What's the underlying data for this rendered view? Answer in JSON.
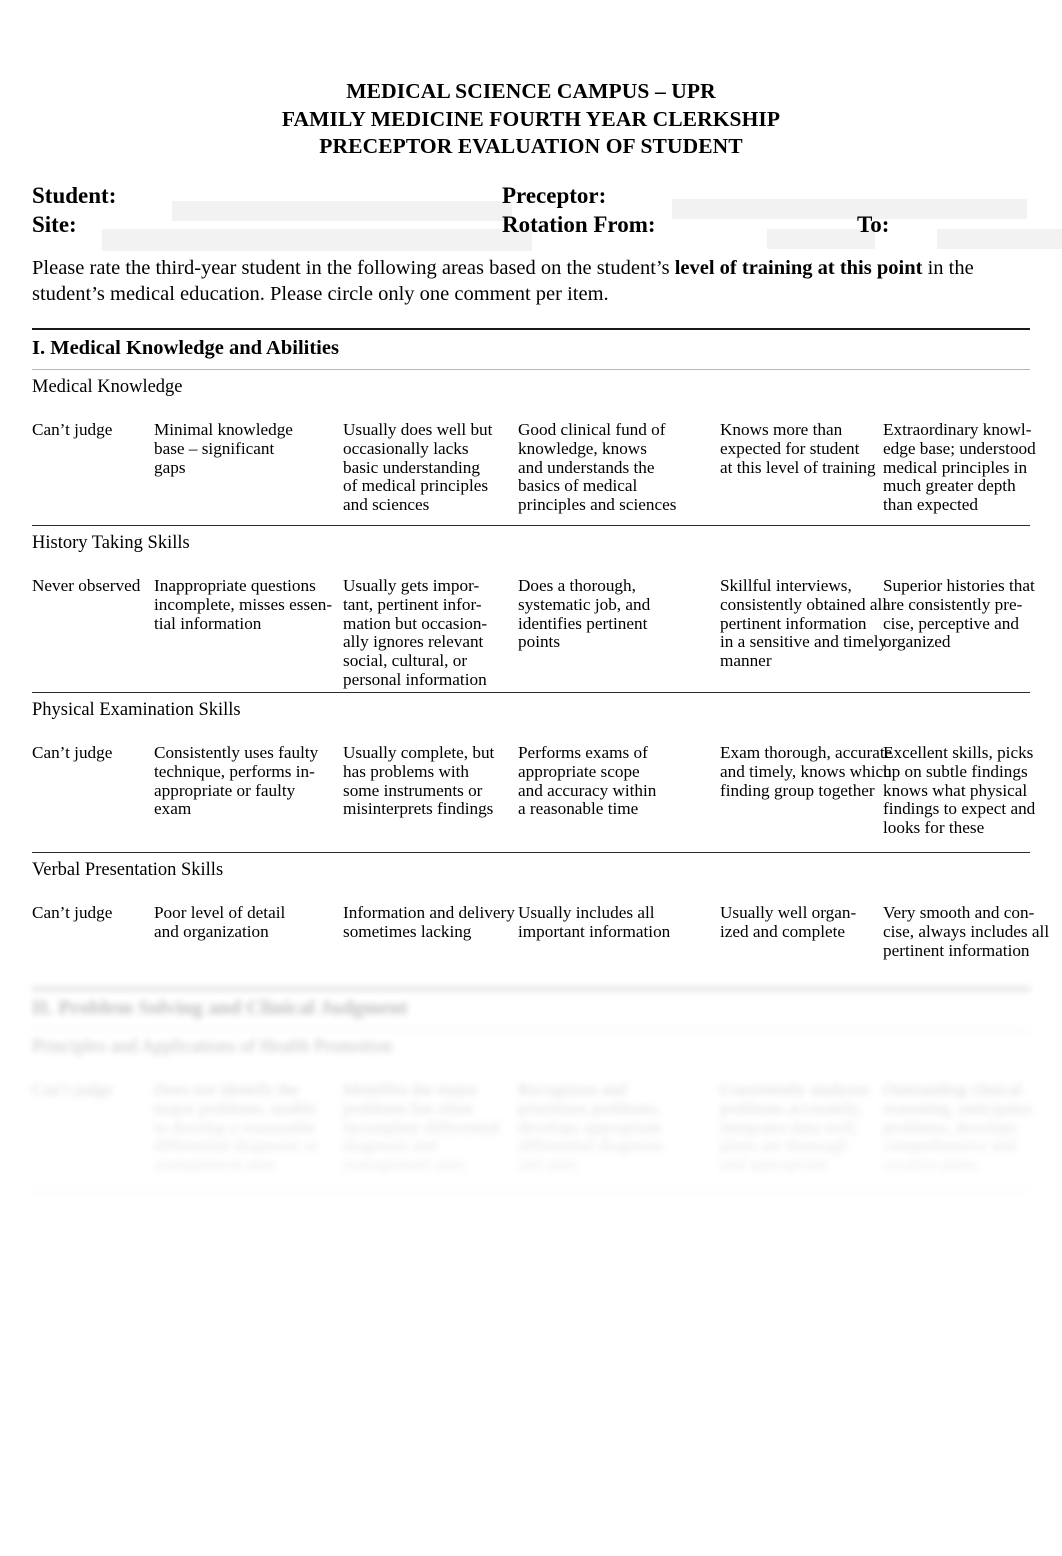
{
  "document": {
    "title_lines": [
      "MEDICAL SCIENCE CAMPUS – UPR",
      "FAMILY MEDICINE FOURTH YEAR CLERKSHIP",
      "PRECEPTOR EVALUATION OF STUDENT"
    ]
  },
  "identification": {
    "student_label": "Student:",
    "site_label": "Site:",
    "preceptor_label": "Preceptor:",
    "rotation_from_label": "Rotation From:",
    "to_label": "To:",
    "student_value": "",
    "site_value": "",
    "preceptor_value": "",
    "rotation_from_value": "",
    "to_value": ""
  },
  "instructions": {
    "part1": "Please rate the third-year student in the following areas based on the student’s ",
    "emphasis": "level of training at this point",
    "part2": " in the student’s medical education.  Please circle only one comment per item."
  },
  "sections": [
    {
      "heading": "I. Medical Knowledge and Abilities",
      "items": [
        {
          "label": "Medical Knowledge",
          "options": [
            "Can’t judge",
            "Minimal knowledge\nbase – significant\ngaps",
            "Usually does well but\noccasionally lacks\nbasic understanding\nof medical principles\nand sciences",
            "Good clinical fund of\nknowledge, knows\nand understands the\nbasics of medical\nprinciples and sciences",
            "Knows more than\nexpected for student\nat this level of training",
            "Extraordinary knowl-\nedge base; understood\nmedical principles in\nmuch greater depth\nthan expected"
          ]
        },
        {
          "label": "History Taking Skills",
          "options": [
            "Never observed",
            "Inappropriate questions\nincomplete, misses essen-\ntial information",
            "Usually gets impor-\ntant, pertinent infor-\nmation but occasion-\nally ignores relevant\nsocial, cultural, or\npersonal information",
            "Does a thorough,\nsystematic job, and\nidentifies pertinent\npoints",
            "Skillful interviews,\nconsistently obtained all\npertinent information\nin a sensitive and timely\nmanner",
            "Superior histories that\nare consistently pre-\ncise, perceptive and\norganized"
          ]
        },
        {
          "label": "Physical Examination Skills",
          "options": [
            "Can’t judge",
            "Consistently uses faulty\ntechnique, performs in-\nappropriate or faulty\nexam",
            "Usually complete, but\nhas problems with\nsome instruments or\nmisinterprets findings",
            "Performs exams of\nappropriate scope\nand accuracy within\na reasonable time",
            "Exam thorough, accurate\nand  timely,  knows which\n finding group together",
            "Excellent skills, picks\nup on subtle findings\nknows what physical\n findings to expect and\nlooks for these"
          ]
        },
        {
          "label": "Verbal Presentation Skills",
          "options": [
            "Can’t judge",
            "Poor level of detail\nand organization",
            "Information and delivery\nsometimes lacking",
            "Usually includes all\nimportant information",
            "Usually well organ-\nized and complete",
            "Very smooth and con-\ncise, always includes all\npertinent information"
          ]
        }
      ]
    },
    {
      "heading": "II. Problem Solving and Clinical Judgment",
      "items": [
        {
          "label": "Principles and Applications of Health Promotion",
          "options": [
            "Can’t judge",
            "Does not identify the\nmajor problems, unable\nto develop a reasonable\ndifferential diagnosis or\nmanagement plan",
            "Identifies the major\nproblems but often\nincomplete differential\ndiagnosis and\nmanagement plan",
            "Recognizes and\nprioritizes problems,\ndevelops appropriate\ndifferential diagnosis\nand plan",
            "Consistently analyzes\nproblems accurately,\nintegrates data well,\nplans are thorough\nand appropriate",
            "Outstanding clinical\nreasoning, anticipates\nproblems, develops\ncomprehensive and\ncreative plans"
          ]
        }
      ]
    }
  ]
}
